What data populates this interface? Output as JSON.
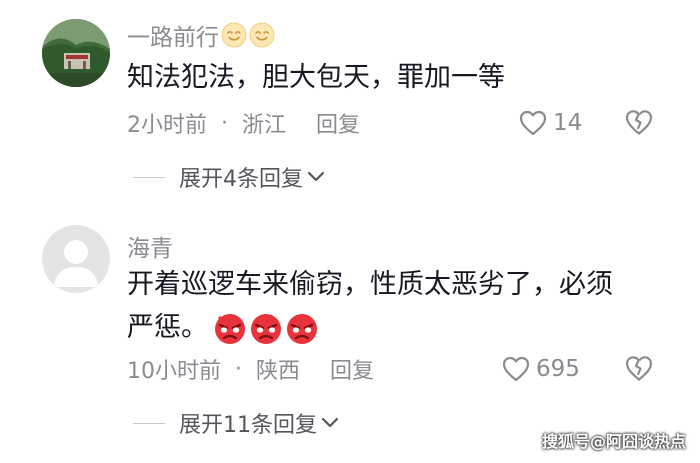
{
  "comments": [
    {
      "username": "一路前行",
      "username_emojis": [
        "smiling-face-emoji",
        "smiling-face-emoji"
      ],
      "text": "知法犯法，胆大包天，罪加一等",
      "time": "2小时前",
      "separator": "·",
      "location": "浙江",
      "reply_label": "回复",
      "likes": "14",
      "expand_label": "展开4条回复"
    },
    {
      "username": "海青",
      "text_line1": "开着巡逻车来偷窃，性质太恶劣了，必须",
      "text_line2": "严惩。",
      "text_emojis": [
        "angry-face-emoji",
        "angry-face-emoji",
        "angry-face-emoji"
      ],
      "time": "10小时前",
      "separator": "·",
      "location": "陕西",
      "reply_label": "回复",
      "likes": "695",
      "expand_label": "展开11条回复"
    }
  ],
  "watermark": "搜狐号@阿囧谈热点",
  "colors": {
    "secondary_text": "#8a8b91",
    "primary_text": "#161823",
    "angry_emoji": "#e8323c"
  }
}
